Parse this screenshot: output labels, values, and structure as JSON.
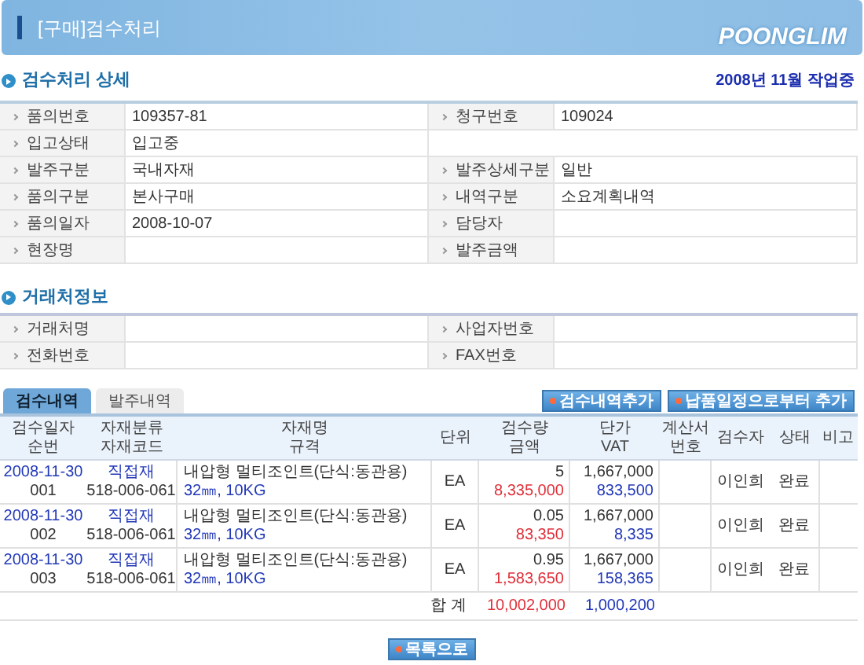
{
  "header": {
    "title": "[구매]검수처리",
    "logo": "POONGLIM"
  },
  "detail": {
    "title": "검수처리 상세",
    "status": "2008년 11월 작업중",
    "rows": [
      [
        {
          "label": "품의번호",
          "value": "109357-81"
        },
        {
          "label": "청구번호",
          "value": "109024"
        }
      ],
      [
        {
          "label": "입고상태",
          "value": "입고중"
        }
      ],
      [
        {
          "label": "발주구분",
          "value": "국내자재"
        },
        {
          "label": "발주상세구분",
          "value": "일반"
        }
      ],
      [
        {
          "label": "품의구분",
          "value": "본사구매"
        },
        {
          "label": "내역구분",
          "value": "소요계획내역"
        }
      ],
      [
        {
          "label": "품의일자",
          "value": "2008-10-07"
        },
        {
          "label": "담당자"
        }
      ],
      [
        {
          "label": "현장명"
        },
        {
          "label": "발주금액"
        }
      ]
    ]
  },
  "vendor": {
    "title": "거래처정보",
    "rows": [
      [
        {
          "label": "거래처명"
        },
        {
          "label": "사업자번호"
        }
      ],
      [
        {
          "label": "전화번호"
        },
        {
          "label": "FAX번호"
        }
      ]
    ]
  },
  "tabs": [
    {
      "label": "검수내역",
      "selected": true
    },
    {
      "label": "발주내역",
      "selected": false
    }
  ],
  "actions": [
    "검수내역추가",
    "납품일정으로부터 추가"
  ],
  "table": {
    "columns": [
      [
        "검수일자",
        "순번"
      ],
      [
        "자재분류",
        "자재코드"
      ],
      [
        "자재명",
        "규격"
      ],
      [
        "단위"
      ],
      [
        "검수량",
        "금액"
      ],
      [
        "단가",
        "VAT"
      ],
      [
        "계산서",
        "번호"
      ],
      [
        "검수자"
      ],
      [
        "상태"
      ],
      [
        "비고"
      ]
    ],
    "rows": [
      {
        "date": "2008-11-30",
        "seq": "001",
        "category": "직접재",
        "code": "518-006-061",
        "name": "내압형 멀티조인트(단식:동관용)",
        "spec": "32㎜, 10KG",
        "unit": "EA",
        "qty": "5",
        "amount": "8,335,000",
        "price": "1,667,000",
        "vat": "833,500",
        "inspector": "이인희",
        "status": "완료"
      },
      {
        "date": "2008-11-30",
        "seq": "002",
        "category": "직접재",
        "code": "518-006-061",
        "name": "내압형 멀티조인트(단식:동관용)",
        "spec": "32㎜, 10KG",
        "unit": "EA",
        "qty": "0.05",
        "amount": "83,350",
        "price": "1,667,000",
        "vat": "8,335",
        "inspector": "이인희",
        "status": "완료"
      },
      {
        "date": "2008-11-30",
        "seq": "003",
        "category": "직접재",
        "code": "518-006-061",
        "name": "내압형 멀티조인트(단식:동관용)",
        "spec": "32㎜, 10KG",
        "unit": "EA",
        "qty": "0.95",
        "amount": "1,583,650",
        "price": "1,667,000",
        "vat": "158,365",
        "inspector": "이인희",
        "status": "완료"
      }
    ],
    "total": {
      "label": "합 계",
      "amount": "10,002,000",
      "vat": "1,000,200"
    }
  },
  "footer_button": "목록으로"
}
